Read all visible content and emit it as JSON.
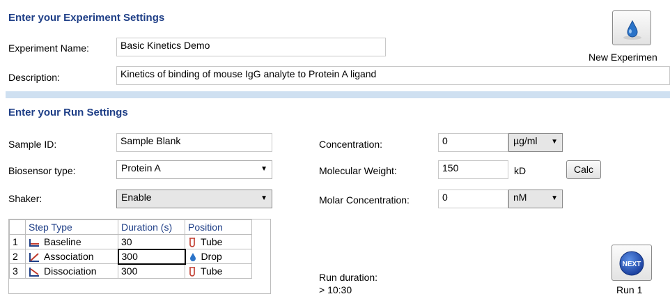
{
  "experiment": {
    "section_title": "Enter your Experiment Settings",
    "name_label": "Experiment Name:",
    "name_value": "Basic Kinetics Demo",
    "description_label": "Description:",
    "description_value": "Kinetics of binding of mouse IgG analyte to Protein A ligand",
    "new_experiment_label": "New Experimen",
    "new_experiment_icon": "drop-icon"
  },
  "run": {
    "section_title": "Enter your Run Settings",
    "sample_id_label": "Sample ID:",
    "sample_id_value": "Sample Blank",
    "biosensor_label": "Biosensor type:",
    "biosensor_value": "Protein A",
    "shaker_label": "Shaker:",
    "shaker_value": "Enable",
    "concentration_label": "Concentration:",
    "concentration_value": "0",
    "concentration_unit": "µg/ml",
    "mw_label": "Molecular Weight:",
    "mw_value": "150",
    "mw_unit": "kD",
    "calc_label": "Calc",
    "molar_label": "Molar Concentration:",
    "molar_value": "0",
    "molar_unit": "nM",
    "duration_label": "Run duration:",
    "duration_value": "> 10:30",
    "next_icon_label": "NEXT",
    "run_label": "Run 1"
  },
  "steps": {
    "headers": [
      "Step Type",
      "Duration (s)",
      "Position"
    ],
    "rows": [
      {
        "index": "1",
        "type": "Baseline",
        "type_icon": "baseline-icon",
        "duration": "30",
        "position": "Tube",
        "position_icon": "tube-icon"
      },
      {
        "index": "2",
        "type": "Association",
        "type_icon": "association-icon",
        "duration": "300",
        "position": "Drop",
        "position_icon": "drop-icon"
      },
      {
        "index": "3",
        "type": "Dissociation",
        "type_icon": "dissociation-icon",
        "duration": "300",
        "position": "Tube",
        "position_icon": "tube-icon"
      }
    ]
  },
  "colors": {
    "section_title": "#1f3f87",
    "divider": "#cfe0f1",
    "drop": "#2a73c8",
    "tube": "#c0392b"
  }
}
